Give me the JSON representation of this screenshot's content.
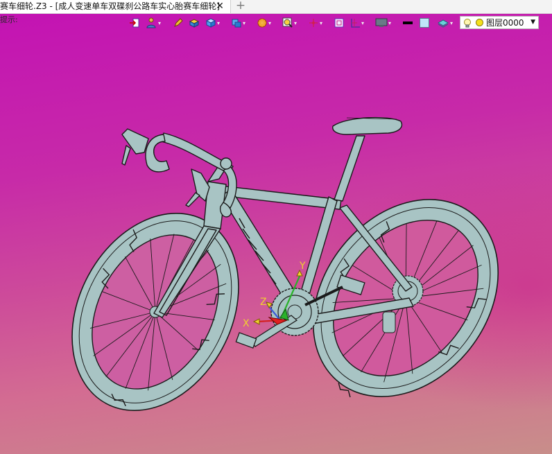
{
  "tab": {
    "title": "赛车细轮.Z3 - [成人变速单车双碟刹公路车实心胎赛车细轮]",
    "close": "✕",
    "add": "+"
  },
  "viewport": {
    "prompt": "提示:",
    "axis_labels": {
      "x": "X",
      "y": "Y",
      "z": "Z"
    }
  },
  "toolbar": {
    "icons": [
      "exit-view-icon",
      "person-icon",
      "pencil-icon",
      "solid-render-icon",
      "cube-icon",
      "shaded-cube-icon",
      "sun-icon",
      "zoom-icon",
      "grid-icon",
      "select-icon",
      "axis-icon",
      "monitor-icon",
      "line-color-icon",
      "fill-color-icon",
      "layer-stack-icon"
    ],
    "layer": {
      "name": "图层0000",
      "arrow": "▼"
    }
  },
  "colors": {
    "bg_top": "#c313b3",
    "bg_bottom": "#c88e8a",
    "bike": "#a8c4c4",
    "bike_line": "#1a1a1a"
  }
}
